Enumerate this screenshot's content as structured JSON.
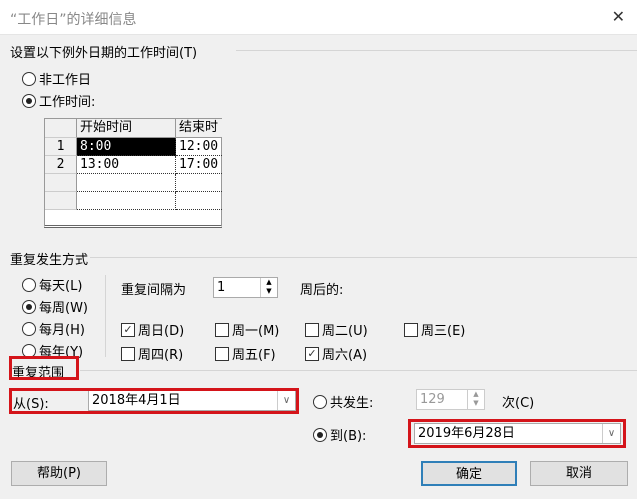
{
  "title": "“工作日”的详细信息",
  "close_icon": "close-icon",
  "section_work_time": "设置以下例外日期的工作时间(T)",
  "radio_nonworking": "非工作日",
  "radio_working_time": "工作时间:",
  "working_time_selected": true,
  "grid": {
    "headers": [
      "开始时间",
      "结束时"
    ],
    "rows": [
      {
        "n": "1",
        "start": "8:00",
        "end": "12:00"
      },
      {
        "n": "2",
        "start": "13:00",
        "end": "17:00"
      }
    ]
  },
  "section_recurrence": "重复发生方式",
  "recurrence": {
    "daily": "每天(L)",
    "weekly": "每周(W)",
    "monthly": "每月(H)",
    "yearly": "每年(Y)",
    "selected": "weekly"
  },
  "interval_label": "重复间隔为",
  "interval_value": "1",
  "weeks_after": "周后的:",
  "days": [
    {
      "label": "周日(D)",
      "checked": true
    },
    {
      "label": "周一(M)",
      "checked": false
    },
    {
      "label": "周二(U)",
      "checked": false
    },
    {
      "label": "周三(E)",
      "checked": false
    },
    {
      "label": "周四(R)",
      "checked": false
    },
    {
      "label": "周五(F)",
      "checked": false
    },
    {
      "label": "周六(A)",
      "checked": true
    }
  ],
  "section_range": "重复范围",
  "from_label": "从(S):",
  "from_value": "2018年4月1日",
  "occurrences_label": "共发生:",
  "occurrences_value": "129",
  "times_label": "次(C)",
  "to_label": "到(B):",
  "to_value": "2019年6月28日",
  "buttons": {
    "help": "帮助(P)",
    "ok": "确定",
    "cancel": "取消"
  },
  "highlight_color": "#d4141a"
}
